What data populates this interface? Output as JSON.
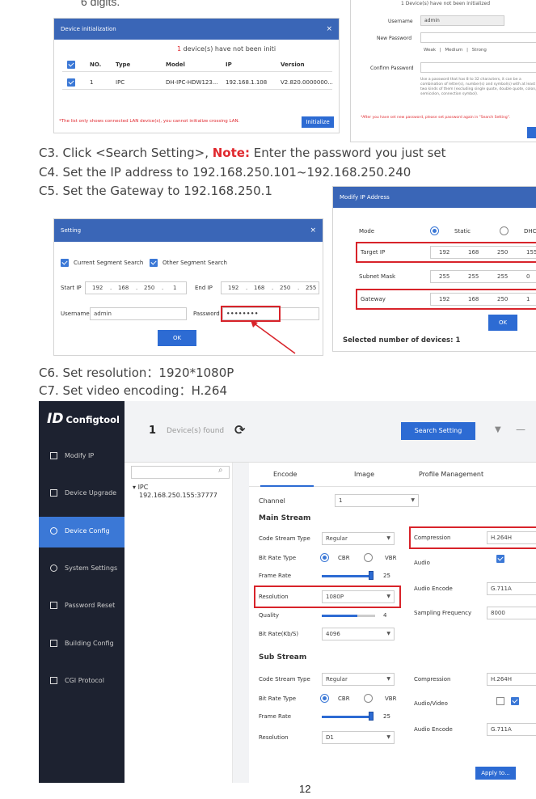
{
  "top_fragment": "6 digits.",
  "init_dialog": {
    "title": "Device initialization",
    "close": "×",
    "count": "1",
    "count_text": "device(s) have not been initi",
    "columns": [
      "NO.",
      "Type",
      "Model",
      "IP",
      "Version"
    ],
    "row": {
      "no": "1",
      "type": "IPC",
      "model": "DH-IPC-HDW123...",
      "ip": "192.168.1.108",
      "version": "V2.820.0000000..."
    },
    "footer_note": "*The list only shows connected LAN device(s), you cannot initialize crossing LAN.",
    "init_button": "Initialize"
  },
  "pwd_dialog": {
    "count_line": "1   Device(s) have not been initialized",
    "username_label": "Username",
    "username_value": "admin",
    "new_password_label": "New Password",
    "strength": [
      "Weak",
      "Medium",
      "Strong"
    ],
    "confirm_label": "Confirm Password",
    "hint": "Use a password that has 8 to 32 characters, it can be a combination of letter(s), number(s) and symbol(s) with at least two kinds of them (excluding single quote, double quote, colon, semicolon, connection symbol).",
    "footer_note": "*After you have set new password, please set password again in \"Search Setting\"."
  },
  "steps": {
    "c3_prefix": "C3.  Click <Search Setting>, ",
    "c3_note": "Note:",
    "c3_suffix": "  Enter the password you just set",
    "c4": "C4. Set the IP address to 192.168.250.101~192.168.250.240",
    "c5": "C5.  Set the Gateway to 192.168.250.1",
    "c6": "C6.   Set resolution：1920*1080P",
    "c7": "C7.   Set video encoding：H.264"
  },
  "setting_dialog": {
    "title": "Setting",
    "close": "×",
    "current_segment": "Current Segment Search",
    "other_segment": "Other Segment Search",
    "start_ip_label": "Start IP",
    "start_ip": [
      "192",
      "168",
      "250",
      "1"
    ],
    "end_ip_label": "End IP",
    "end_ip": [
      "192",
      "168",
      "250",
      "255"
    ],
    "username_label": "Username",
    "username_value": "admin",
    "password_label": "Password",
    "password_value": "••••••••",
    "ok": "OK"
  },
  "modify_ip": {
    "title": "Modify IP Address",
    "mode_label": "Mode",
    "mode_static": "Static",
    "mode_dhcp": "DHC",
    "target_ip_label": "Target IP",
    "target_ip": [
      "192",
      "168",
      "250",
      "155"
    ],
    "subnet_label": "Subnet Mask",
    "subnet": [
      "255",
      "255",
      "255",
      "0"
    ],
    "gateway_label": "Gateway",
    "gateway": [
      "192",
      "168",
      "250",
      "1"
    ],
    "ok": "OK",
    "selected": "Selected number of devices: 1"
  },
  "configtool": {
    "brand": "Configtool",
    "found_count": "1",
    "found_text": "Device(s) found",
    "search_setting": "Search Setting",
    "sidebar": [
      "Modify IP",
      "Device Upgrade",
      "Device Config",
      "System Settings",
      "Password Reset",
      "Building Config",
      "CGI Protocol"
    ],
    "tree_root": "IPC",
    "tree_device": "192.168.250.155:37777",
    "tabs": [
      "Encode",
      "Image",
      "Profile Management"
    ],
    "channel_label": "Channel",
    "channel_value": "1",
    "main_stream": "Main Stream",
    "sub_stream": "Sub Stream",
    "code_stream_type_label": "Code Stream Type",
    "code_stream_type": "Regular",
    "bit_rate_type_label": "Bit Rate Type",
    "cbr": "CBR",
    "vbr": "VBR",
    "frame_rate_label": "Frame Rate",
    "frame_rate": "25",
    "resolution_label": "Resolution",
    "resolution_main": "1080P",
    "quality_label": "Quality",
    "quality": "4",
    "bitrate_label": "Bit Rate(Kb/S)",
    "bitrate": "4096",
    "compression_label": "Compression",
    "compression": "H.264H",
    "audio_label": "Audio",
    "audio_encode_label": "Audio Encode",
    "audio_encode": "G.711A",
    "sampling_label": "Sampling Frequency",
    "sampling": "8000",
    "sub_resolution": "D1",
    "audio_video_label": "Audio/Video",
    "apply": "Apply to..."
  },
  "page_number": "12"
}
